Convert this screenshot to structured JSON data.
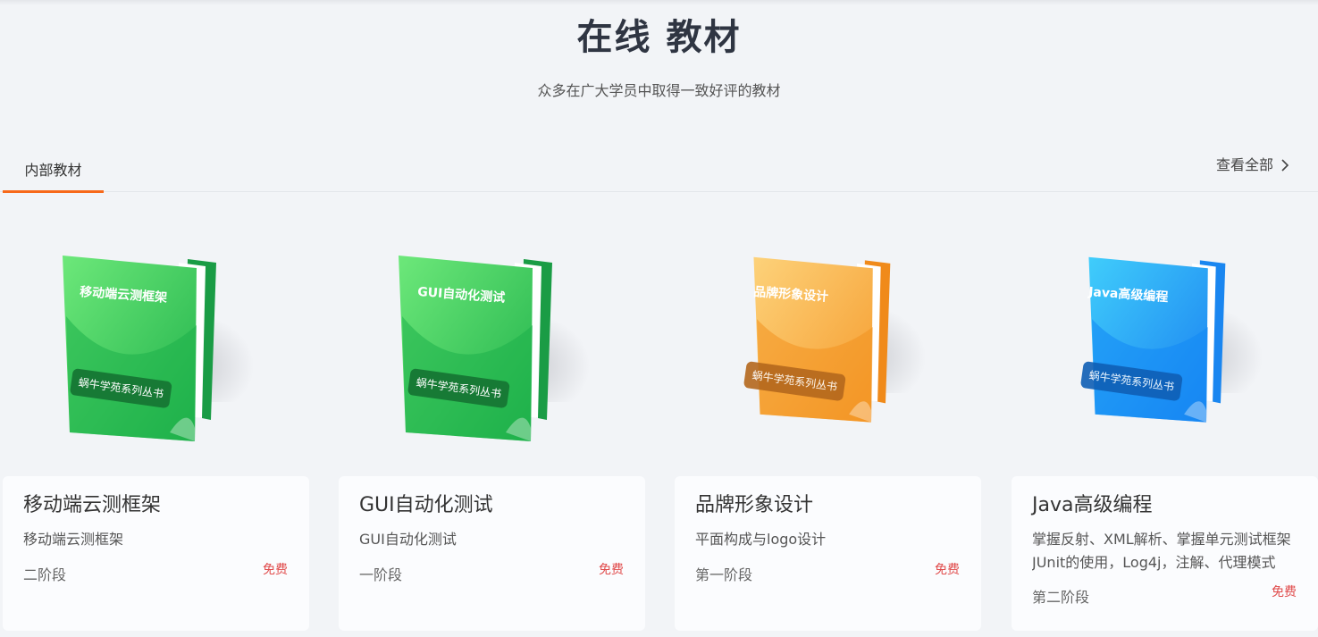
{
  "header": {
    "title": "在线 教材",
    "subtitle": "众多在广大学员中取得一致好评的教材"
  },
  "tabs": [
    {
      "label": "内部教材",
      "active": true
    }
  ],
  "view_all": {
    "label": "查看全部",
    "icon": "chevron-right-icon"
  },
  "books": [
    {
      "cover_title": "移动端云测框架",
      "cover_series": "蜗牛学苑系列丛书",
      "cover_color": "green",
      "title": "移动端云测框架",
      "description": "移动端云测框架",
      "stage": "二阶段",
      "price": "免费"
    },
    {
      "cover_title": "GUI自动化测试",
      "cover_series": "蜗牛学苑系列丛书",
      "cover_color": "green",
      "title": "GUI自动化测试",
      "description": "GUI自动化测试",
      "stage": "一阶段",
      "price": "免费"
    },
    {
      "cover_title": "品牌形象设计",
      "cover_series": "蜗牛学苑系列丛书",
      "cover_color": "orange",
      "title": "品牌形象设计",
      "description": "平面构成与logo设计",
      "stage": "第一阶段",
      "price": "免费"
    },
    {
      "cover_title": "Java高级编程",
      "cover_series": "蜗牛学苑系列丛书",
      "cover_color": "blue",
      "title": "Java高级编程",
      "description": "掌握反射、XML解析、掌握单元测试框架JUnit的使用，Log4j，注解、代理模式",
      "stage": "第二阶段",
      "price": "免费"
    }
  ],
  "colors": {
    "accent": "#f7691a",
    "price": "#e04a4a",
    "green": "#22c55e",
    "orange": "#f59e2a",
    "blue": "#1e90ff"
  }
}
